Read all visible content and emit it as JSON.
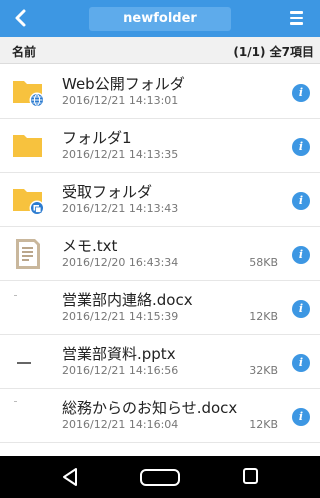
{
  "header": {
    "title": "newfolder"
  },
  "columns": {
    "name": "名前",
    "count": "(1/1) 全7項目"
  },
  "items": [
    {
      "name": "Web公開フォルダ",
      "date": "2016/12/21 14:13:01",
      "size": "",
      "icon": "folder-web-icon"
    },
    {
      "name": "フォルダ1",
      "date": "2016/12/21 14:13:35",
      "size": "",
      "icon": "folder-icon"
    },
    {
      "name": "受取フォルダ",
      "date": "2016/12/21 14:13:43",
      "size": "",
      "icon": "folder-inbox-icon"
    },
    {
      "name": "メモ.txt",
      "date": "2016/12/20 16:43:34",
      "size": "58KB",
      "icon": "text-file-icon"
    },
    {
      "name": "営業部内連絡.docx",
      "date": "2016/12/21 14:15:39",
      "size": "12KB",
      "icon": "docx-thumbnail-icon"
    },
    {
      "name": "営業部資料.pptx",
      "date": "2016/12/21 14:16:56",
      "size": "32KB",
      "icon": "pptx-thumbnail-icon"
    },
    {
      "name": "総務からのお知らせ.docx",
      "date": "2016/12/21 14:16:04",
      "size": "12KB",
      "icon": "docx-thumbnail-icon"
    }
  ],
  "colors": {
    "accent": "#3d97e3",
    "folder": "#f7c23e"
  }
}
